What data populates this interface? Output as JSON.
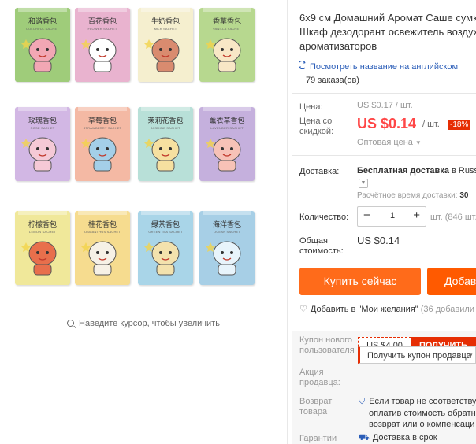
{
  "gallery": {
    "zoom_hint": "Наведите курсор, чтобы увеличить",
    "sachets": [
      {
        "label": "和谐香包",
        "sub": "COLORFUL SACHET",
        "color": "#9fcc7a",
        "face": "#f2a7b4"
      },
      {
        "label": "百花香包",
        "sub": "FLOWER SACHET",
        "color": "#e9b3cf",
        "face": "#ffffff"
      },
      {
        "label": "牛奶香包",
        "sub": "MILK SACHET",
        "color": "#f5efcf",
        "face": "#d98b6f"
      },
      {
        "label": "香草香包",
        "sub": "VANILLA SACHET",
        "color": "#b7d88f",
        "face": "#f8e7c6"
      },
      {
        "label": "玫瑰香包",
        "sub": "ROSE SACHET",
        "color": "#d2b7e4",
        "face": "#f5c9d6"
      },
      {
        "label": "草莓香包",
        "sub": "STRAWBERRY SACHET",
        "color": "#f4b9a4",
        "face": "#a4cfe8"
      },
      {
        "label": "茉莉花香包",
        "sub": "JASMINE SACHET",
        "color": "#b8e0d8",
        "face": "#f6e0a0"
      },
      {
        "label": "薰衣草香包",
        "sub": "LAVENDER SACHET",
        "color": "#c5b0dd",
        "face": "#f7c2b7"
      },
      {
        "label": "柠檬香包",
        "sub": "LEMON SACHET",
        "color": "#f0e89a",
        "face": "#e86f4c"
      },
      {
        "label": "桂花香包",
        "sub": "OSMANTHUS SACHET",
        "color": "#f6dc8f",
        "face": "#f6f1e6"
      },
      {
        "label": "绿茶香包",
        "sub": "GREEN TEA SACHET",
        "color": "#a9d5e8",
        "face": "#f3e2ad"
      },
      {
        "label": "海洋香包",
        "sub": "OCEAN SACHET",
        "color": "#a7cfe6",
        "face": "#e8f4fb"
      }
    ]
  },
  "product": {
    "title_lines": [
      "6x9 см Домашний Аромат Саше сумк",
      "Шкаф дезодорант освежитель воздух",
      "ароматизаторов"
    ],
    "translate_link": "Посмотреть название на английском",
    "orders": "79 заказа(ов)"
  },
  "price": {
    "label": "Цена:",
    "old": "US $0.17 / шт.",
    "discount_label_1": "Цена со",
    "discount_label_2": "скидкой:",
    "new": "US $0.14",
    "unit": "/ шт.",
    "badge": "-18%",
    "wholesale": "Оптовая цена"
  },
  "shipping": {
    "label": "Доставка:",
    "free_text": "Бесплатная доставка",
    "to": "в Russia",
    "estimate_label": "Расчётное время доставки:",
    "estimate_value": "30"
  },
  "quantity": {
    "label": "Количество:",
    "value": "1",
    "minus": "−",
    "plus": "+",
    "available": "шт. (846 шт."
  },
  "total": {
    "label_1": "Общая",
    "label_2": "стоимость:",
    "value": "US $0.14"
  },
  "actions": {
    "buy_now": "Купить сейчас",
    "add_to_cart": "Добав",
    "wishlist_text": "Добавить в \"Мои желания\"",
    "wishlist_count": "(36 добавили"
  },
  "coupons": {
    "new_user_label_1": "Купон нового",
    "new_user_label_2": "пользователя",
    "new_user_value": "US $4.00",
    "new_user_button": "ПОЛУЧИТЬ",
    "seller_label_1": "Акция",
    "seller_label_2": "продавца:",
    "seller_select": "Получить купон продавца",
    "return_label_1": "Возврат",
    "return_label_2": "товара",
    "return_lines": [
      "Если товар не соответствуе",
      "оплатив стоимость обратно",
      "возврат или о компенсаци"
    ],
    "guarantee_label": "Гарантии",
    "guarantee_text": "Доставка в срок"
  },
  "colors": {
    "price_red": "#ff4747",
    "buy_orange": "#ff6b1a",
    "cart_orange": "#ff5a00",
    "link_blue": "#2a5db8",
    "coupon_red": "#e62e04"
  }
}
